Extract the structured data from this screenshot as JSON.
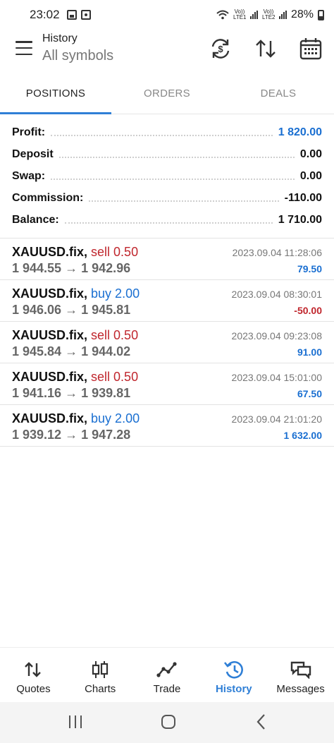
{
  "status_bar": {
    "time": "23:02",
    "sim1_label": "Vo)) LTE1",
    "sim2_label": "Vo)) LTE2",
    "battery": "28%"
  },
  "header": {
    "title": "History",
    "subtitle": "All symbols"
  },
  "tabs": [
    {
      "label": "POSITIONS",
      "active": true
    },
    {
      "label": "ORDERS",
      "active": false
    },
    {
      "label": "DEALS",
      "active": false
    }
  ],
  "summary": {
    "profit_label": "Profit:",
    "profit_value": "1 820.00",
    "deposit_label": "Deposit",
    "deposit_value": "0.00",
    "swap_label": "Swap:",
    "swap_value": "0.00",
    "commission_label": "Commission:",
    "commission_value": "-110.00",
    "balance_label": "Balance:",
    "balance_value": "1 710.00"
  },
  "deals": [
    {
      "symbol": "XAUUSD.fix,",
      "side": "sell 0.50",
      "direction": "sell",
      "prices": "1 944.55 → 1 942.96",
      "datetime": "2023.09.04 11:28:06",
      "profit": "79.50",
      "profit_sign": "pos"
    },
    {
      "symbol": "XAUUSD.fix,",
      "side": "buy 2.00",
      "direction": "buy",
      "prices": "1 946.06 → 1 945.81",
      "datetime": "2023.09.04 08:30:01",
      "profit": "-50.00",
      "profit_sign": "neg"
    },
    {
      "symbol": "XAUUSD.fix,",
      "side": "sell 0.50",
      "direction": "sell",
      "prices": "1 945.84 → 1 944.02",
      "datetime": "2023.09.04 09:23:08",
      "profit": "91.00",
      "profit_sign": "pos"
    },
    {
      "symbol": "XAUUSD.fix,",
      "side": "sell 0.50",
      "direction": "sell",
      "prices": "1 941.16 → 1 939.81",
      "datetime": "2023.09.04 15:01:00",
      "profit": "67.50",
      "profit_sign": "pos"
    },
    {
      "symbol": "XAUUSD.fix,",
      "side": "buy 2.00",
      "direction": "buy",
      "prices": "1 939.12 → 1 947.28",
      "datetime": "2023.09.04 21:01:20",
      "profit": "1 632.00",
      "profit_sign": "pos"
    }
  ],
  "bottom_nav": [
    {
      "label": "Quotes",
      "icon": "quotes-arrows-icon",
      "active": false
    },
    {
      "label": "Charts",
      "icon": "candlestick-icon",
      "active": false
    },
    {
      "label": "Trade",
      "icon": "trade-line-icon",
      "active": false
    },
    {
      "label": "History",
      "icon": "history-clock-icon",
      "active": true
    },
    {
      "label": "Messages",
      "icon": "messages-icon",
      "active": false
    }
  ],
  "colors": {
    "accent": "#2f7fd6",
    "sell": "#c0262d",
    "buy": "#1a6fd1",
    "profit_positive": "#1a6fd1",
    "profit_negative": "#c0262d"
  }
}
